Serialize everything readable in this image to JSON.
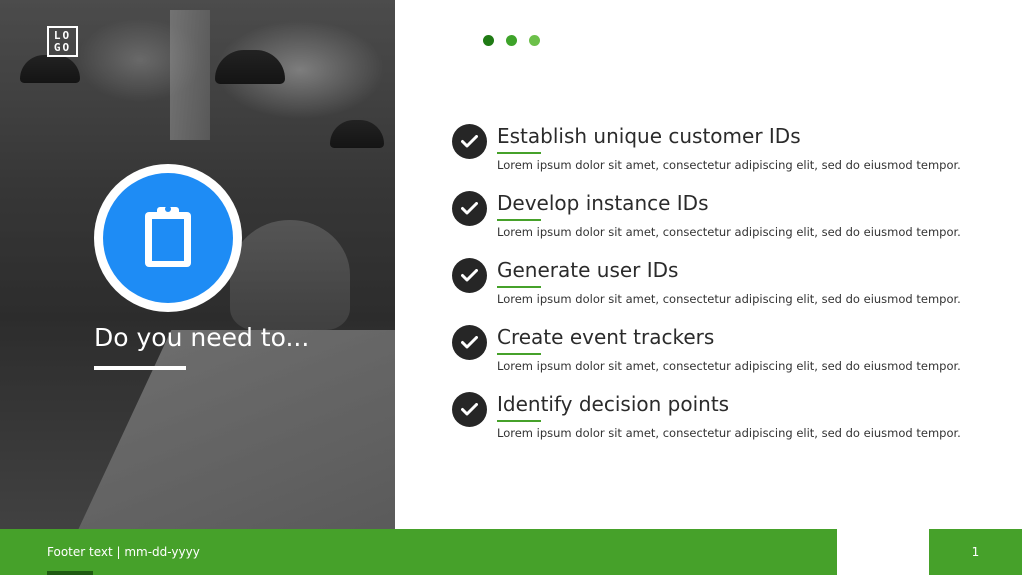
{
  "logo": {
    "text": "LO\nGO"
  },
  "left": {
    "heading": "Do you need to..."
  },
  "progress_dots": {
    "colors": [
      "#1f7a14",
      "#3ea32a",
      "#6cc04a"
    ]
  },
  "items": [
    {
      "title": "Establish unique customer IDs",
      "description": "Lorem ipsum dolor sit amet, consectetur adipiscing elit, sed do eiusmod tempor."
    },
    {
      "title": "Develop instance IDs",
      "description": "Lorem ipsum dolor sit amet, consectetur adipiscing elit, sed do eiusmod tempor."
    },
    {
      "title": "Generate user IDs",
      "description": "Lorem ipsum dolor sit amet, consectetur adipiscing elit, sed do eiusmod tempor."
    },
    {
      "title": "Create event trackers",
      "description": "Lorem ipsum dolor sit amet, consectetur adipiscing elit, sed do eiusmod tempor."
    },
    {
      "title": "Identify decision points",
      "description": "Lorem ipsum dolor sit amet, consectetur adipiscing elit, sed do eiusmod tempor."
    }
  ],
  "footer": {
    "text": "Footer text | mm-dd-yyyy",
    "page_number": "1"
  },
  "colors": {
    "accent_green": "#46a12a",
    "icon_blue": "#1e8cf5",
    "check_dark": "#262626"
  },
  "icons": {
    "main": "clipboard-icon",
    "bullet": "check-icon"
  }
}
